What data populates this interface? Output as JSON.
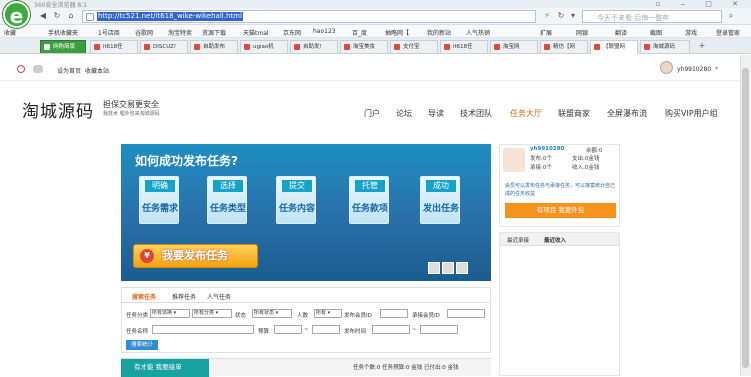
{
  "browser": {
    "title": "360安全浏览器 8.1",
    "url": "http://tc521.net/it618_wike-wikehall.html",
    "search_placeholder": "今天不来看 后悔一整年",
    "favorites": [
      "收藏",
      "手机收藏夹",
      "1号店商",
      "谷歌网",
      "淘宝特卖",
      "资源下载",
      "天猫tmal",
      "京东网",
      "hao123",
      "百_度",
      "抽略网【",
      "我的新站",
      "人气热销"
    ],
    "favorites_right": [
      "扩展",
      "网银",
      "翻译",
      "截图",
      "游戏",
      "登录管家"
    ],
    "tabs": [
      "网购简版",
      "it618任",
      "DISCUZ!",
      "自助发布",
      "ugiao机",
      "自助发!",
      "淘宝美妆",
      "支付宝",
      "it618任",
      "淘宝网",
      "精仿【网",
      "【联盟网",
      "淘城源码"
    ]
  },
  "site": {
    "top_links": [
      "设为首页",
      "收藏本站"
    ],
    "username_top": "yh9910280",
    "brand": "淘城源码",
    "slogan": "担保交易更安全",
    "sub_slogan": "我技术 嘘外包来淘城源码",
    "nav": [
      "门户",
      "论坛",
      "导读",
      "技术团队",
      "任务大厅",
      "联盟商家",
      "全屏瀑布流",
      "购买VIP用户组"
    ]
  },
  "banner": {
    "title": "如何成功发布任务?",
    "steps": [
      {
        "head": "明确",
        "body": "任务需求"
      },
      {
        "head": "选择",
        "body": "任务类型"
      },
      {
        "head": "提交",
        "body": "任务内容"
      },
      {
        "head": "托管",
        "body": "任务款项"
      },
      {
        "head": "成功",
        "body": "发出任务"
      }
    ],
    "publish_button": "我要发布任务",
    "publish_icon": "¥"
  },
  "profile": {
    "username": "yh9910280",
    "balance_label": "余额:0",
    "posted_label": "发布:0个",
    "paid_label": "支出:0金钱",
    "accepted_label": "承接:0个",
    "income_label": "收入:0金钱",
    "hint": "会员可以发布任务与承接任务，可以接案统计自己成的任务收益",
    "action_button": "有项目  我要外包"
  },
  "records": {
    "tab1": "最近承接",
    "tab2": "最近收入"
  },
  "search": {
    "tabs": [
      "搜索任务",
      "推荐任务",
      "人气任务"
    ],
    "row1": {
      "category_label": "任务分类",
      "category_value": "所有派换",
      "subcategory_value": "所有分类",
      "status_label": "状态",
      "status_value": "所有状态",
      "people_label": "人数",
      "people_value": "所有",
      "publisher_label": "发布会员ID",
      "accepter_label": "承接会员ID"
    },
    "row2": {
      "name_label": "任务名称",
      "budget_label": "预算",
      "dash": "~",
      "time_label": "发布时间",
      "dash2": "~"
    },
    "submit": "搜索统计"
  },
  "bottom": {
    "left_tab": "有才能 我要接单",
    "stats": "任务个数:0  任务预算:0 金钱 已付出:0 金钱"
  }
}
